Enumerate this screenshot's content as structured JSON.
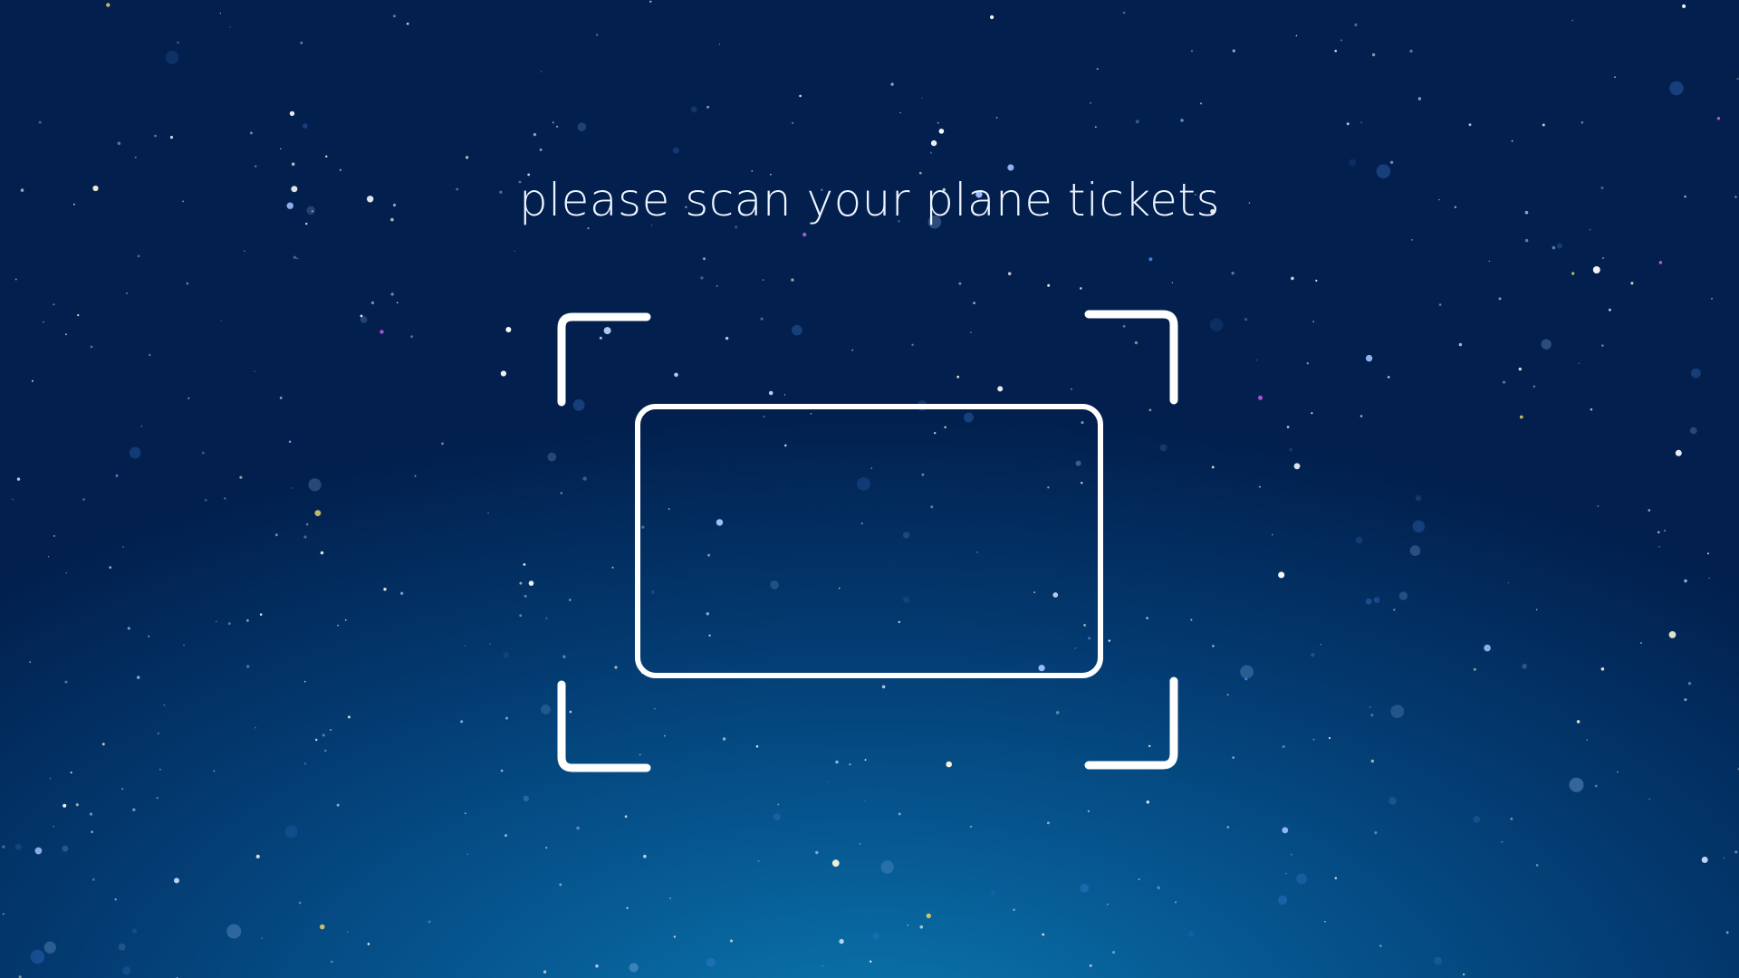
{
  "prompt": {
    "text": "please scan your plane tickets"
  },
  "scanner": {
    "frame_icon": "scan-frame-icon",
    "ticket_outline_icon": "ticket-outline-icon",
    "stroke_color": "#ffffff"
  },
  "background": {
    "top_color": "#021f4d",
    "bottom_glow_color": "#0b78ad",
    "star_color": "#ffffff"
  }
}
